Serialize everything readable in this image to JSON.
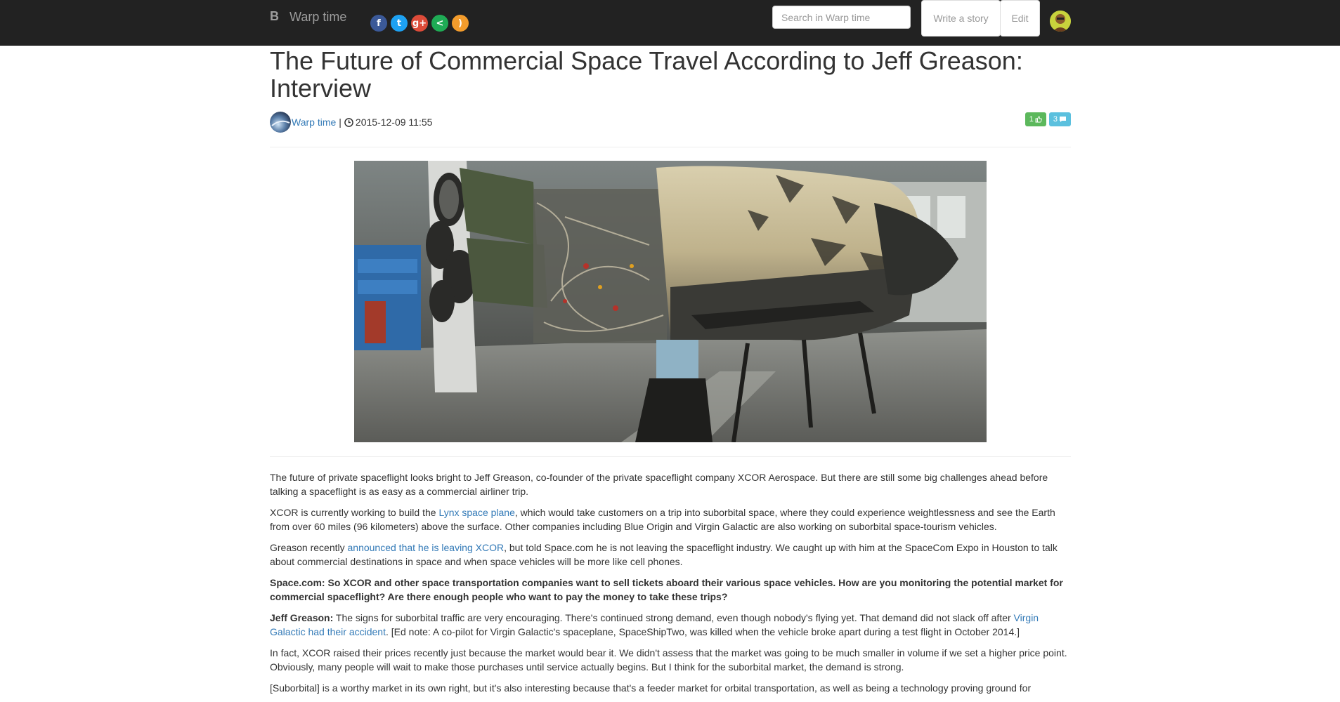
{
  "navbar": {
    "brand_letter": "B",
    "brand_name": "Warp time",
    "social": [
      {
        "name": "facebook",
        "glyph": "f",
        "color": "#3b5998"
      },
      {
        "name": "twitter",
        "glyph": "t",
        "color": "#1da1f2"
      },
      {
        "name": "google-plus",
        "glyph": "g+",
        "color": "#dd4b39"
      },
      {
        "name": "share",
        "glyph": "<",
        "color": "#1fab55"
      },
      {
        "name": "rss",
        "glyph": ")",
        "color": "#f39c2c"
      }
    ],
    "search_placeholder": "Search in Warp time",
    "write_story_label": "Write a story",
    "edit_label": "Edit"
  },
  "article": {
    "title": "The Future of Commercial Space Travel According to Jeff Greason: Interview",
    "author": "Warp time",
    "separator": "|",
    "timestamp": "2015-12-09 11:55",
    "likes": "1",
    "comments": "3",
    "paragraphs": [
      [
        {
          "text": "The future of private spaceflight looks bright to Jeff Greason, co-founder of the private spaceflight company XCOR Aerospace. But there are still some big challenges ahead before talking a spaceflight is as easy as a commercial airliner trip."
        }
      ],
      [
        {
          "text": "XCOR is currently working to build the "
        },
        {
          "text": "Lynx space plane",
          "link": true
        },
        {
          "text": ", which would take customers on a trip into suborbital space, where they could experience weightlessness and see the Earth from over 60 miles (96 kilometers) above the surface. Other companies including Blue Origin and Virgin Galactic are also working on suborbital space-tourism vehicles."
        }
      ],
      [
        {
          "text": "Greason recently "
        },
        {
          "text": "announced that he is leaving XCOR",
          "link": true
        },
        {
          "text": ", but told Space.com he is not leaving the spaceflight industry. We caught up with him at the SpaceCom Expo in Houston to talk about commercial destinations in space and when space vehicles will be more like cell phones."
        }
      ],
      [
        {
          "text": "Space.com: So XCOR and other space transportation companies want to sell tickets aboard their various space vehicles. How are you monitoring the potential market for commercial spaceflight? Are there enough people who want to pay the money to take these trips?",
          "bold": true
        }
      ],
      [
        {
          "text": "Jeff Greason:",
          "bold": true
        },
        {
          "text": " The signs for suborbital traffic are very encouraging. There's continued strong demand, even though nobody's flying yet. That demand did not slack off after "
        },
        {
          "text": "Virgin Galactic had their accident",
          "link": true
        },
        {
          "text": ". [Ed note: A co-pilot for Virgin Galactic's spaceplane, SpaceShipTwo, was killed when the vehicle broke apart during a test flight in October 2014.]"
        }
      ],
      [
        {
          "text": "In fact, XCOR raised their prices recently just because the market would bear it. We didn't assess that the market was going to be much smaller in volume if we set a higher price point. Obviously, many people will wait to make those purchases until service actually begins. But I think for the suborbital market, the demand is strong."
        }
      ],
      [
        {
          "text": "[Suborbital] is a worthy market in its own right, but it's also interesting because that's a feeder market for orbital transportation, as well as being a technology proving ground for"
        }
      ]
    ]
  }
}
